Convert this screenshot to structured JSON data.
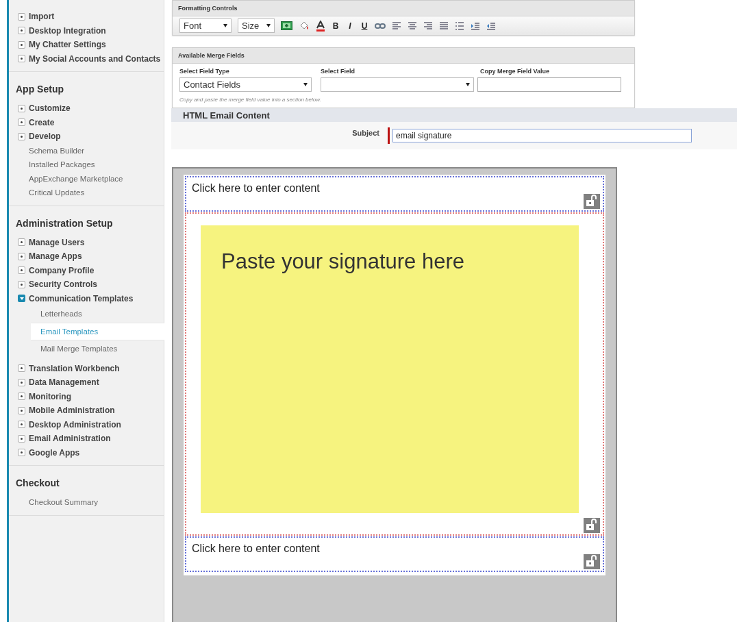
{
  "sidebar": {
    "sections": [
      {
        "items": [
          {
            "label": "Import",
            "kind": "expandable",
            "expanded": false,
            "selected": false
          },
          {
            "label": "Desktop Integration",
            "kind": "expandable",
            "expanded": false,
            "selected": false
          },
          {
            "label": "My Chatter Settings",
            "kind": "expandable",
            "expanded": false,
            "selected": false
          },
          {
            "label": "My Social Accounts and Contacts",
            "kind": "expandable",
            "expanded": false,
            "selected": false
          }
        ]
      },
      {
        "heading": "App Setup",
        "items": [
          {
            "label": "Customize",
            "kind": "expandable",
            "expanded": false,
            "selected": false
          },
          {
            "label": "Create",
            "kind": "expandable",
            "expanded": false,
            "selected": false
          },
          {
            "label": "Develop",
            "kind": "expandable",
            "expanded": false,
            "selected": false
          },
          {
            "label": "Schema Builder",
            "kind": "link",
            "selected": false
          },
          {
            "label": "Installed Packages",
            "kind": "link",
            "selected": false
          },
          {
            "label": "AppExchange Marketplace",
            "kind": "link",
            "selected": false
          },
          {
            "label": "Critical Updates",
            "kind": "link",
            "selected": false
          }
        ]
      },
      {
        "heading": "Administration Setup",
        "items": [
          {
            "label": "Manage Users",
            "kind": "expandable",
            "expanded": false,
            "selected": false
          },
          {
            "label": "Manage Apps",
            "kind": "expandable",
            "expanded": false,
            "selected": false
          },
          {
            "label": "Company Profile",
            "kind": "expandable",
            "expanded": false,
            "selected": false
          },
          {
            "label": "Security Controls",
            "kind": "expandable",
            "expanded": false,
            "selected": false
          },
          {
            "label": "Communication Templates",
            "kind": "expandable",
            "expanded": true,
            "selected": false,
            "children": [
              {
                "label": "Letterheads",
                "selected": false
              },
              {
                "label": "Email Templates",
                "selected": true
              },
              {
                "label": "Mail Merge Templates",
                "selected": false
              }
            ]
          },
          {
            "label": "Translation Workbench",
            "kind": "expandable",
            "expanded": false,
            "selected": false
          },
          {
            "label": "Data Management",
            "kind": "expandable",
            "expanded": false,
            "selected": false
          },
          {
            "label": "Monitoring",
            "kind": "expandable",
            "expanded": false,
            "selected": false
          },
          {
            "label": "Mobile Administration",
            "kind": "expandable",
            "expanded": false,
            "selected": false
          },
          {
            "label": "Desktop Administration",
            "kind": "expandable",
            "expanded": false,
            "selected": false
          },
          {
            "label": "Email Administration",
            "kind": "expandable",
            "expanded": false,
            "selected": false
          },
          {
            "label": "Google Apps",
            "kind": "expandable",
            "expanded": false,
            "selected": false
          }
        ]
      },
      {
        "heading": "Checkout",
        "items": [
          {
            "label": "Checkout Summary",
            "kind": "link",
            "selected": false
          }
        ]
      }
    ]
  },
  "formatting_controls": {
    "title": "Formatting Controls",
    "tools": [
      {
        "kind": "select",
        "label": "Font"
      },
      {
        "kind": "select",
        "label": "Size"
      },
      {
        "kind": "image"
      },
      {
        "kind": "fill"
      },
      {
        "kind": "color"
      },
      {
        "kind": "char",
        "label": "B"
      },
      {
        "kind": "char",
        "label": "I"
      },
      {
        "kind": "char",
        "label": "U"
      },
      {
        "kind": "link"
      },
      {
        "kind": "align-left"
      },
      {
        "kind": "align-center"
      },
      {
        "kind": "align-right"
      },
      {
        "kind": "justify"
      },
      {
        "kind": "list"
      },
      {
        "kind": "indent"
      },
      {
        "kind": "outdent"
      }
    ]
  },
  "merge_fields": {
    "title": "Available Merge Fields",
    "fields": [
      {
        "label": "Select Field Type",
        "kind": "select",
        "value": "Contact Fields"
      },
      {
        "label": "Select Field",
        "kind": "select"
      },
      {
        "label": "Copy Merge Field Value",
        "kind": "text"
      }
    ],
    "hint": "Copy and paste the merge field value into a section below."
  },
  "content": {
    "title": "HTML Email Content",
    "subject": {
      "label": "Subject",
      "value": "email signature"
    }
  },
  "editor": {
    "sections": [
      {
        "kind": "text",
        "text": "Click here to enter content",
        "selected": false
      },
      {
        "kind": "picture",
        "text": "Paste your signature here",
        "selected": true
      },
      {
        "kind": "text",
        "text": "Click here to enter content",
        "selected": false
      }
    ]
  }
}
